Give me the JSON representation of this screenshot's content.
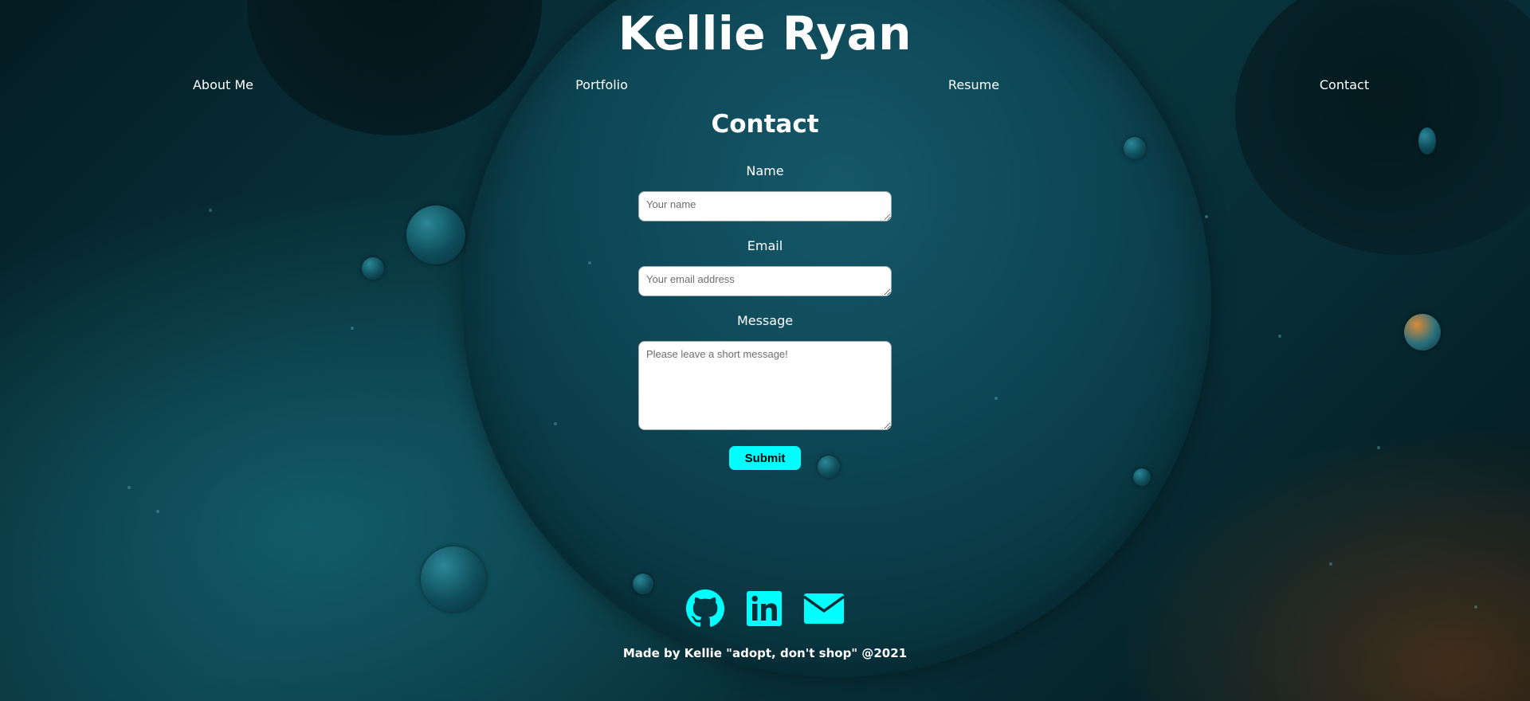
{
  "header": {
    "title": "Kellie Ryan"
  },
  "nav": {
    "items": [
      "About Me",
      "Portfolio",
      "Resume",
      "Contact"
    ]
  },
  "contact": {
    "heading": "Contact",
    "name_label": "Name",
    "name_placeholder": "Your name",
    "email_label": "Email",
    "email_placeholder": "Your email address",
    "message_label": "Message",
    "message_placeholder": "Please leave a short message!",
    "submit_label": "Submit"
  },
  "footer": {
    "social_icons": [
      "github-icon",
      "linkedin-icon",
      "email-icon"
    ],
    "text": "Made by Kellie \"adopt, don't shop\" @2021"
  },
  "colors": {
    "accent": "#00ffff",
    "text": "#ffffff",
    "background": "#0a3a44"
  }
}
